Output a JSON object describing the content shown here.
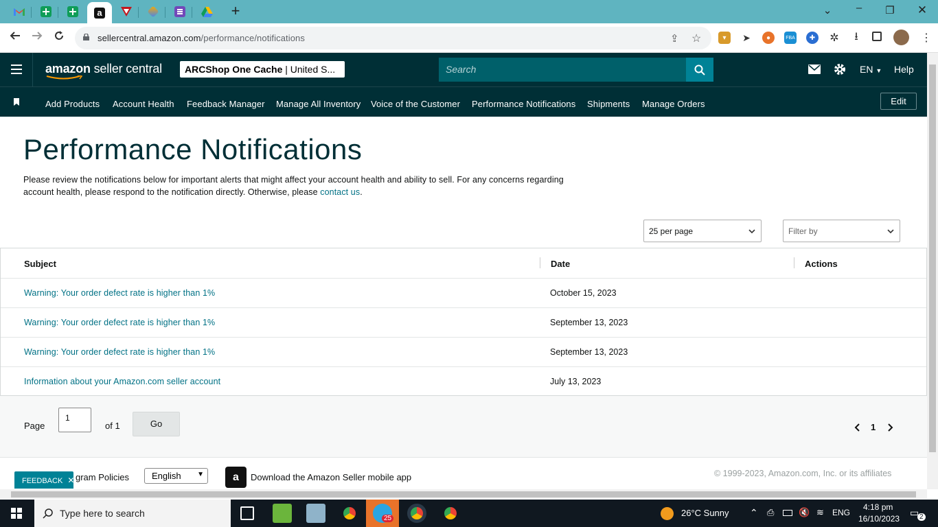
{
  "browser": {
    "tabs": [
      {
        "icon": "gmail-icon"
      },
      {
        "icon": "sheets-icon"
      },
      {
        "icon": "sheets-icon"
      },
      {
        "icon": "amazon-icon",
        "active": true
      },
      {
        "icon": "vivaldi-icon"
      },
      {
        "icon": "gem-icon"
      },
      {
        "icon": "forms-icon"
      },
      {
        "icon": "drive-icon"
      }
    ],
    "url_domain": "sellercentral.amazon.com",
    "url_path": "/performance/notifications"
  },
  "header": {
    "logo_amazon": "amazon",
    "logo_suffix": " seller central",
    "store_bold": "ARCShop One Cache",
    "store_rest": " | United S...",
    "search_placeholder": "Search",
    "language": "EN",
    "help": "Help"
  },
  "nav": {
    "links": [
      "Add Products",
      "Account Health",
      "Feedback Manager",
      "Manage All Inventory",
      "Voice of the Customer",
      "Performance Notifications",
      "Shipments",
      "Manage Orders"
    ],
    "edit_label": "Edit"
  },
  "main": {
    "title": "Performance Notifications",
    "intro_text": "Please review the notifications below for important alerts that might affect your account health and ability to sell. For any concerns regarding account health, please respond to the notification directly. Otherwise, please ",
    "intro_link": "contact us",
    "intro_end": ".",
    "per_page": "25 per page",
    "filter_placeholder": "Filter by"
  },
  "table": {
    "headers": {
      "subject": "Subject",
      "date": "Date",
      "actions": "Actions"
    },
    "rows": [
      {
        "subject": "Warning: Your order defect rate is higher than 1%",
        "date": "October 15, 2023"
      },
      {
        "subject": "Warning: Your order defect rate is higher than 1%",
        "date": "September 13, 2023"
      },
      {
        "subject": "Warning: Your order defect rate is higher than 1%",
        "date": "September 13, 2023"
      },
      {
        "subject": "Information about your Amazon.com seller account",
        "date": "July 13, 2023"
      }
    ]
  },
  "pager": {
    "page_label": "Page",
    "page_value": "1",
    "of_label": "of 1",
    "go_label": "Go",
    "current": "1"
  },
  "footer": {
    "policies": "gram Policies",
    "language": "English",
    "app_text": "Download the Amazon Seller mobile app",
    "copyright": "© 1999-2023, Amazon.com, Inc. or its affiliates",
    "feedback": "FEEDBACK"
  },
  "taskbar": {
    "search_placeholder": "Type here to search",
    "badge": "25",
    "weather": "26°C  Sunny",
    "lang": "ENG",
    "time": "4:18 pm",
    "date": "16/10/2023",
    "notifications": "2"
  },
  "colors": {
    "header_bg": "#002f36",
    "link": "#007185",
    "accent": "#008296"
  }
}
